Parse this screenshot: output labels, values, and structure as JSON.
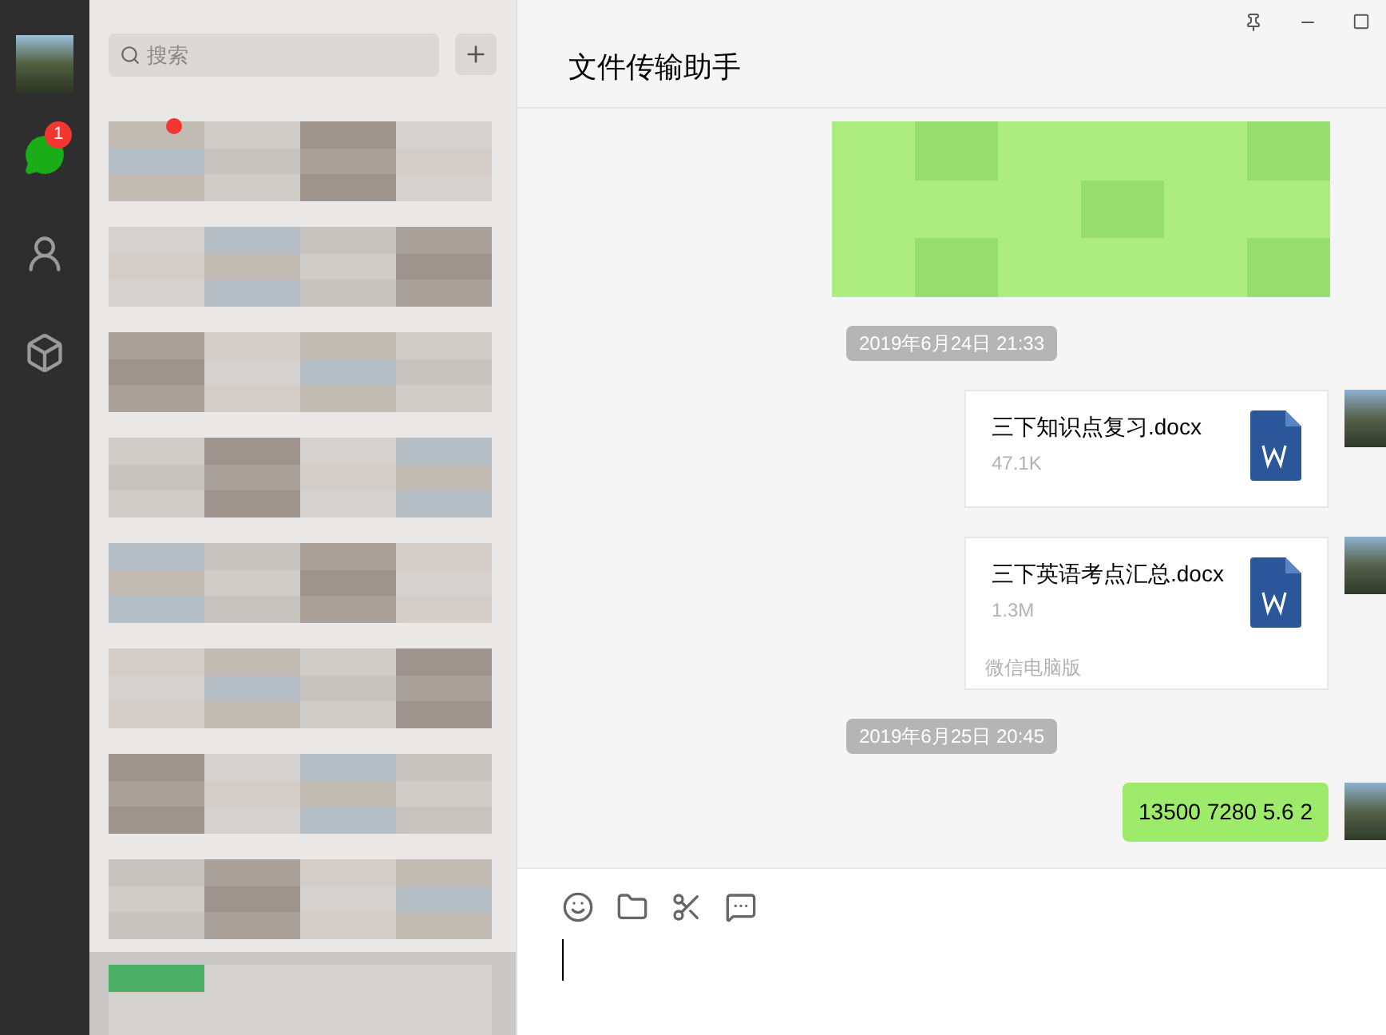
{
  "sidebar": {
    "items": [
      {
        "kind": "chat",
        "selected": true,
        "badge": "1"
      },
      {
        "kind": "contacts",
        "selected": false
      },
      {
        "kind": "favorites",
        "selected": false
      }
    ]
  },
  "search": {
    "placeholder": "搜索"
  },
  "chats": [
    {
      "selected": false,
      "unread": true
    },
    {
      "selected": false,
      "unread": false
    },
    {
      "selected": false,
      "unread": false
    },
    {
      "selected": false,
      "unread": false
    },
    {
      "selected": false,
      "unread": false
    },
    {
      "selected": false,
      "unread": false
    },
    {
      "selected": false,
      "unread": false
    },
    {
      "selected": false,
      "unread": false
    },
    {
      "selected": true,
      "unread": false
    }
  ],
  "conversation": {
    "title": "文件传输助手",
    "messages": [
      {
        "kind": "blurred"
      },
      {
        "kind": "time",
        "text": "2019年6月24日  21:33"
      },
      {
        "kind": "file",
        "name": "三下知识点复习.docx",
        "size": "47.1K"
      },
      {
        "kind": "file",
        "name": "三下英语考点汇总.docx",
        "size": "1.3M",
        "source": "微信电脑版"
      },
      {
        "kind": "time",
        "text": "2019年6月25日  20:45"
      },
      {
        "kind": "text",
        "text": "13500 7280 5.6 2"
      }
    ]
  }
}
